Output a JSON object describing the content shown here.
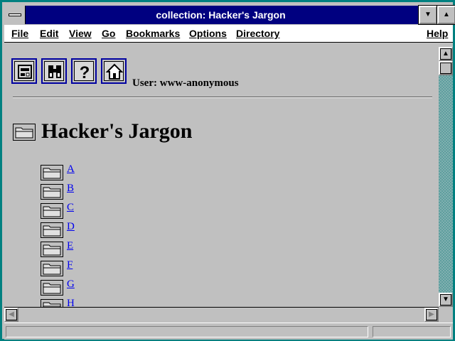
{
  "window": {
    "title": "collection: Hacker's Jargon"
  },
  "menu": {
    "file": "File",
    "edit": "Edit",
    "view": "View",
    "go": "Go",
    "bookmarks": "Bookmarks",
    "options": "Options",
    "directory": "Directory",
    "help": "Help"
  },
  "toolbar": {
    "buttons": [
      "collections-icon",
      "search-icon",
      "help-icon",
      "home-icon"
    ],
    "user_label": "User: www-anonymous"
  },
  "page": {
    "title": "Hacker's Jargon",
    "entries": [
      "A",
      "B",
      "C",
      "D",
      "E",
      "F",
      "G",
      "H"
    ]
  },
  "colors": {
    "titlebar": "#000080",
    "background": "#c0c0c0",
    "link": "#0000ee",
    "desktop": "#008080"
  }
}
